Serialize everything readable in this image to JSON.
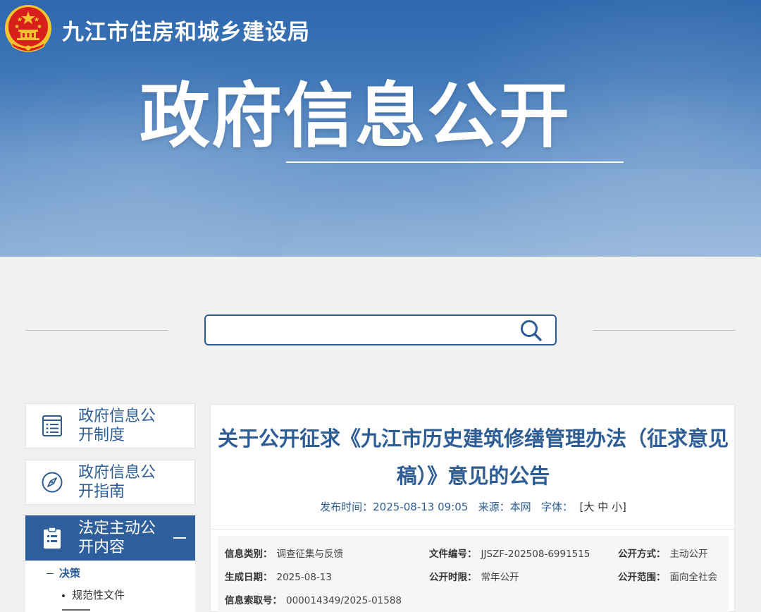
{
  "header": {
    "site_name": "九江市住房和城乡建设局",
    "hero_title": "政府信息公开"
  },
  "search": {
    "value": "",
    "placeholder": ""
  },
  "sidebar": {
    "items": [
      {
        "label": "政府信息公开制度",
        "icon": "document-list-icon"
      },
      {
        "label": "政府信息公开指南",
        "icon": "compass-icon"
      },
      {
        "label": "法定主动公开内容",
        "icon": "clipboard-icon",
        "collapse_symbol": "—"
      }
    ],
    "sub_category": "决策",
    "sub_items": [
      "规范性文件"
    ]
  },
  "article": {
    "title": "关于公开征求《九江市历史建筑修缮管理办法（征求意见稿）》意见的公告",
    "publish_label": "发布时间：",
    "publish_value": "2025-08-13 09:05",
    "source_label": "来源：",
    "source_value": "本网",
    "font_label": "字体：",
    "font_open": "[",
    "font_large": "大",
    "font_medium": "中",
    "font_small": "小",
    "font_close": "]"
  },
  "info": {
    "category_label": "信息类别：",
    "category_value": "调查征集与反馈",
    "doc_no_label": "文件编号：",
    "doc_no_value": "JJSZF-202508-6991515",
    "open_method_label": "公开方式：",
    "open_method_value": "主动公开",
    "gen_date_label": "生成日期：",
    "gen_date_value": "2025-08-13",
    "open_period_label": "公开时限：",
    "open_period_value": "常年公开",
    "open_scope_label": "公开范围：",
    "open_scope_value": "面向全社会",
    "index_label": "信息索取号：",
    "index_value": "000014349/2025-01588"
  },
  "colors": {
    "primary": "#2e5c95",
    "banner_top": "#2d67ad",
    "emblem_red": "#d7201b",
    "emblem_gold": "#f4c430"
  }
}
